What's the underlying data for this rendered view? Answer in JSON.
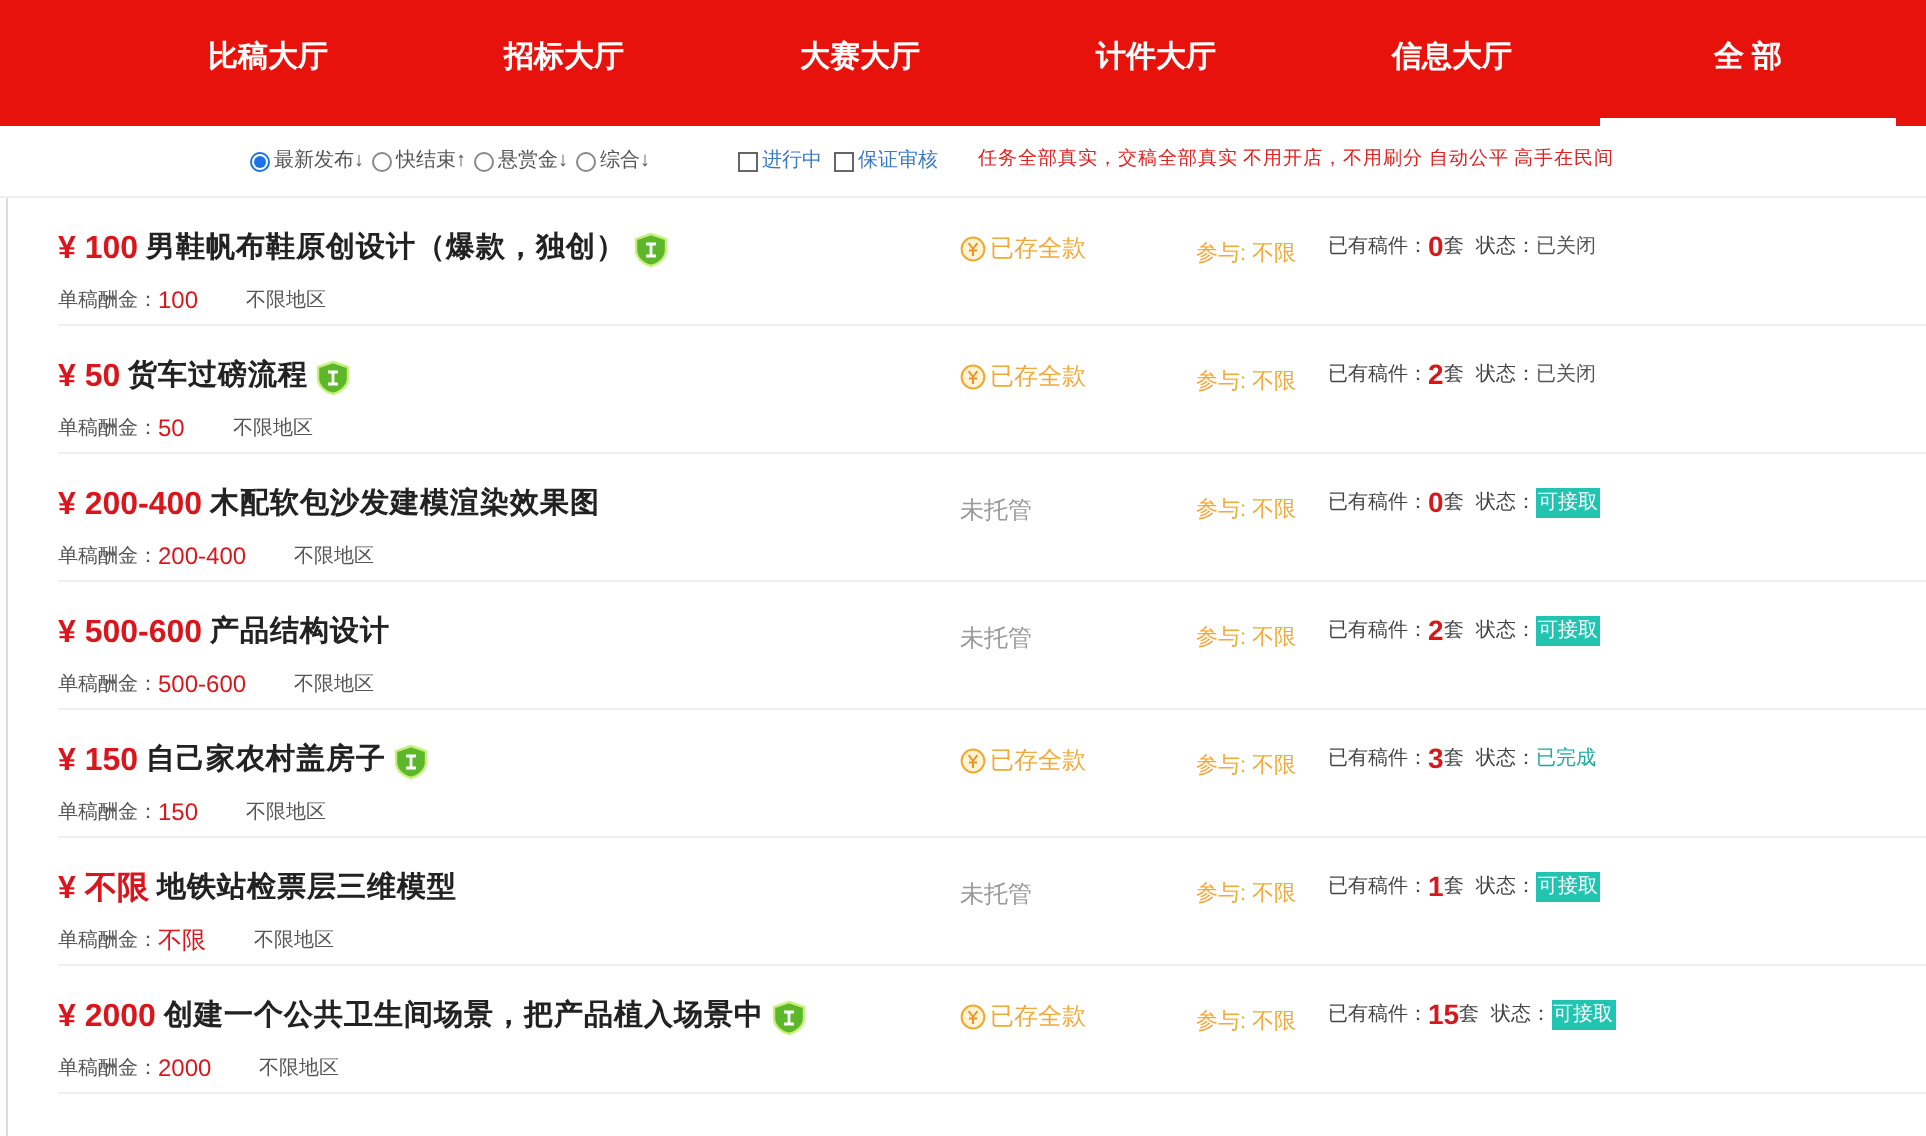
{
  "nav_tabs": [
    {
      "label": "比稿大厅",
      "selected": false
    },
    {
      "label": "招标大厅",
      "selected": false
    },
    {
      "label": "大赛大厅",
      "selected": false
    },
    {
      "label": "计件大厅",
      "selected": false
    },
    {
      "label": "信息大厅",
      "selected": false
    },
    {
      "label": "全 部",
      "selected": true
    }
  ],
  "sort_options": [
    {
      "label": "最新发布↓",
      "selected": true
    },
    {
      "label": "快结束↑",
      "selected": false
    },
    {
      "label": "悬赏金↓",
      "selected": false
    },
    {
      "label": "综合↓",
      "selected": false
    }
  ],
  "filter_checkboxes": [
    {
      "label": "进行中",
      "checked": false
    },
    {
      "label": "保证审核",
      "checked": false
    }
  ],
  "notice": "任务全部真实，交稿全部真实 不用开店，不用刷分 自动公平 高手在民间",
  "tasks": [
    {
      "price": "¥ 100",
      "title": "男鞋帆布鞋原创设计（爆款，独创）",
      "guaranteed": true,
      "unit_label": "单稿酬金：",
      "unit_value": "100",
      "region": "不限地区",
      "deposit": {
        "kind": "paid",
        "text": "已存全款"
      },
      "participate": "参与: 不限",
      "submissions_label": "已有稿件：",
      "count": "0",
      "count_unit": "套",
      "status_label": "状态：",
      "status": {
        "kind": "closed",
        "text": "已关闭"
      }
    },
    {
      "price": "¥ 50",
      "title": "货车过磅流程",
      "guaranteed": true,
      "unit_label": "单稿酬金：",
      "unit_value": "50",
      "region": "不限地区",
      "deposit": {
        "kind": "paid",
        "text": "已存全款"
      },
      "participate": "参与: 不限",
      "submissions_label": "已有稿件：",
      "count": "2",
      "count_unit": "套",
      "status_label": "状态：",
      "status": {
        "kind": "closed",
        "text": "已关闭"
      }
    },
    {
      "price": "¥ 200-400",
      "title": "木配软包沙发建模渲染效果图",
      "guaranteed": false,
      "unit_label": "单稿酬金：",
      "unit_value": "200-400",
      "region": "不限地区",
      "deposit": {
        "kind": "none",
        "text": "未托管"
      },
      "participate": "参与: 不限",
      "submissions_label": "已有稿件：",
      "count": "0",
      "count_unit": "套",
      "status_label": "状态：",
      "status": {
        "kind": "open",
        "text": "可接取"
      }
    },
    {
      "price": "¥ 500-600",
      "title": "产品结构设计",
      "guaranteed": false,
      "unit_label": "单稿酬金：",
      "unit_value": "500-600",
      "region": "不限地区",
      "deposit": {
        "kind": "none",
        "text": "未托管"
      },
      "participate": "参与: 不限",
      "submissions_label": "已有稿件：",
      "count": "2",
      "count_unit": "套",
      "status_label": "状态：",
      "status": {
        "kind": "open",
        "text": "可接取"
      }
    },
    {
      "price": "¥ 150",
      "title": "自己家农村盖房子",
      "guaranteed": true,
      "unit_label": "单稿酬金：",
      "unit_value": "150",
      "region": "不限地区",
      "deposit": {
        "kind": "paid",
        "text": "已存全款"
      },
      "participate": "参与: 不限",
      "submissions_label": "已有稿件：",
      "count": "3",
      "count_unit": "套",
      "status_label": "状态：",
      "status": {
        "kind": "done",
        "text": "已完成"
      }
    },
    {
      "price": "¥ 不限",
      "title": "地铁站检票层三维模型",
      "guaranteed": false,
      "unit_label": "单稿酬金：",
      "unit_value": "不限",
      "region": "不限地区",
      "deposit": {
        "kind": "none",
        "text": "未托管"
      },
      "participate": "参与: 不限",
      "submissions_label": "已有稿件：",
      "count": "1",
      "count_unit": "套",
      "status_label": "状态：",
      "status": {
        "kind": "open",
        "text": "可接取"
      }
    },
    {
      "price": "¥ 2000",
      "title": "创建一个公共卫生间场景，把产品植入场景中",
      "guaranteed": true,
      "unit_label": "单稿酬金：",
      "unit_value": "2000",
      "region": "不限地区",
      "deposit": {
        "kind": "paid",
        "text": "已存全款"
      },
      "participate": "参与: 不限",
      "submissions_label": "已有稿件：",
      "count": "15",
      "count_unit": "套",
      "status_label": "状态：",
      "status": {
        "kind": "open",
        "text": "可接取"
      }
    }
  ]
}
